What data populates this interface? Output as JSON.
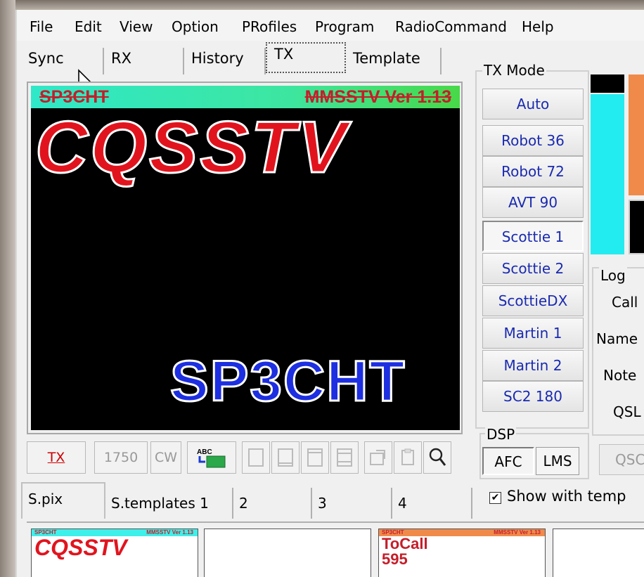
{
  "menu": {
    "items": [
      "File",
      "Edit",
      "View",
      "Option",
      "PRofiles",
      "Program",
      "RadioCommand",
      "Help"
    ]
  },
  "tabs": [
    "Sync",
    "RX",
    "History",
    "TX",
    "Template"
  ],
  "active_tab": "TX",
  "image": {
    "header_left": "SP3CHT",
    "header_right": "MMSSTV Ver 1.13",
    "main_text": "CQSSTV",
    "callsign_text": "SP3CHT"
  },
  "tx_mode": {
    "label": "TX Mode",
    "buttons": [
      "Auto",
      "Robot 36",
      "Robot 72",
      "AVT 90",
      "Scottie 1",
      "Scottie 2",
      "ScottieDX",
      "Martin 1",
      "Martin 2",
      "SC2 180"
    ],
    "selected": "Scottie 1"
  },
  "log": {
    "label": "Log",
    "fields": [
      "Call",
      "Name",
      "Note",
      "QSL"
    ],
    "qsc_label": "QSC"
  },
  "toolbar": {
    "tx_label": "TX",
    "tone_label": "1750",
    "cw_label": "CW",
    "abc_label": "ABC"
  },
  "dsp": {
    "label": "DSP",
    "afc_label": "AFC",
    "lms_label": "LMS"
  },
  "bottom_tabs": [
    "S.pix",
    "S.templates 1",
    "2",
    "3",
    "4"
  ],
  "show_with_template": {
    "label": "Show with temp",
    "checked": true,
    "mark": "✔"
  },
  "thumbnails": [
    {
      "header_left": "SP3CHT",
      "header_right": "MMSSTV Ver 1.13",
      "text": "CQSSTV"
    },
    {},
    {
      "header_left": "SP3CHT",
      "header_right": "MMSSTV Ver 1.13",
      "text": "ToCall",
      "text2": "595"
    },
    {}
  ],
  "colors": {
    "mode_text": "#1a2ab0",
    "cq_red": "#e1141e",
    "call_blue": "#1d2fe0",
    "header_green": "#3de6a0",
    "meter_cyan": "#22ecf0",
    "meter_orange": "#f08a4b"
  }
}
